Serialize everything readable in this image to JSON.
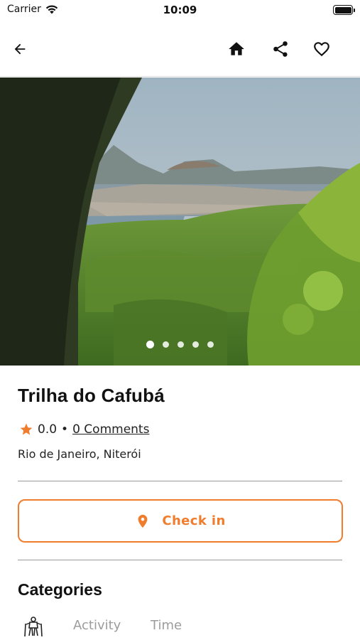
{
  "status_bar": {
    "carrier": "Carrier",
    "time": "10:09",
    "battery_level": 1.0
  },
  "nav": {
    "back_icon": "arrow-left-icon",
    "home_icon": "home-icon",
    "share_icon": "share-icon",
    "favorite_icon": "heart-outline-icon"
  },
  "gallery": {
    "image_count": 5,
    "active_index": 0
  },
  "place": {
    "name": "Trilha do Cafubá",
    "rating": "0.0",
    "separator": "•",
    "comments_label": "0 Comments",
    "location": "Rio de Janeiro, Niterói"
  },
  "checkin": {
    "label": "Check in",
    "icon": "map-pin-icon"
  },
  "categories": {
    "title": "Categories",
    "icon": "hiker-icon",
    "tabs": [
      "Activity",
      "Time"
    ]
  },
  "colors": {
    "accent": "#ef7d2d",
    "star": "#ef7d2d",
    "muted_text": "#9c9c9c",
    "divider": "#9a9a9a"
  }
}
